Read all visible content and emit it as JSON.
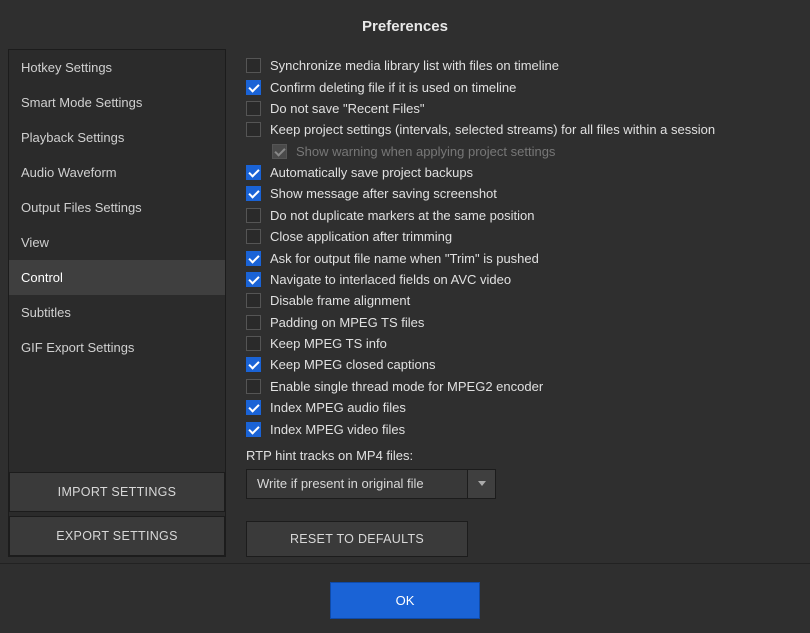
{
  "title": "Preferences",
  "sidebar": {
    "items": [
      {
        "label": "Hotkey Settings",
        "selected": false
      },
      {
        "label": "Smart Mode Settings",
        "selected": false
      },
      {
        "label": "Playback Settings",
        "selected": false
      },
      {
        "label": "Audio Waveform",
        "selected": false
      },
      {
        "label": "Output Files Settings",
        "selected": false
      },
      {
        "label": "View",
        "selected": false
      },
      {
        "label": "Control",
        "selected": true
      },
      {
        "label": "Subtitles",
        "selected": false
      },
      {
        "label": "GIF Export Settings",
        "selected": false
      }
    ],
    "import_label": "IMPORT SETTINGS",
    "export_label": "EXPORT SETTINGS"
  },
  "options": [
    {
      "label": "Synchronize media library list with files on timeline",
      "checked": false,
      "indented": false,
      "disabled": false
    },
    {
      "label": "Confirm deleting file if it is used on timeline",
      "checked": true,
      "indented": false,
      "disabled": false
    },
    {
      "label": "Do not save \"Recent Files\"",
      "checked": false,
      "indented": false,
      "disabled": false
    },
    {
      "label": "Keep project settings (intervals, selected streams) for all files within a session",
      "checked": false,
      "indented": false,
      "disabled": false
    },
    {
      "label": "Show warning when applying project settings",
      "checked": true,
      "indented": true,
      "disabled": true
    },
    {
      "label": "Automatically save project backups",
      "checked": true,
      "indented": false,
      "disabled": false
    },
    {
      "label": "Show message after saving screenshot",
      "checked": true,
      "indented": false,
      "disabled": false
    },
    {
      "label": "Do not duplicate markers at the same position",
      "checked": false,
      "indented": false,
      "disabled": false
    },
    {
      "label": "Close application after trimming",
      "checked": false,
      "indented": false,
      "disabled": false
    },
    {
      "label": "Ask for output file name when \"Trim\" is pushed",
      "checked": true,
      "indented": false,
      "disabled": false
    },
    {
      "label": "Navigate to interlaced fields on AVC video",
      "checked": true,
      "indented": false,
      "disabled": false
    },
    {
      "label": "Disable frame alignment",
      "checked": false,
      "indented": false,
      "disabled": false
    },
    {
      "label": "Padding on MPEG TS files",
      "checked": false,
      "indented": false,
      "disabled": false
    },
    {
      "label": "Keep MPEG TS info",
      "checked": false,
      "indented": false,
      "disabled": false
    },
    {
      "label": "Keep MPEG closed captions",
      "checked": true,
      "indented": false,
      "disabled": false
    },
    {
      "label": "Enable single thread mode for MPEG2 encoder",
      "checked": false,
      "indented": false,
      "disabled": false
    },
    {
      "label": "Index MPEG audio files",
      "checked": true,
      "indented": false,
      "disabled": false
    },
    {
      "label": "Index MPEG video files",
      "checked": true,
      "indented": false,
      "disabled": false
    }
  ],
  "dropdown": {
    "title": "RTP hint tracks on MP4 files:",
    "value": "Write if present in original file"
  },
  "reset_label": "RESET TO DEFAULTS",
  "ok_label": "OK"
}
